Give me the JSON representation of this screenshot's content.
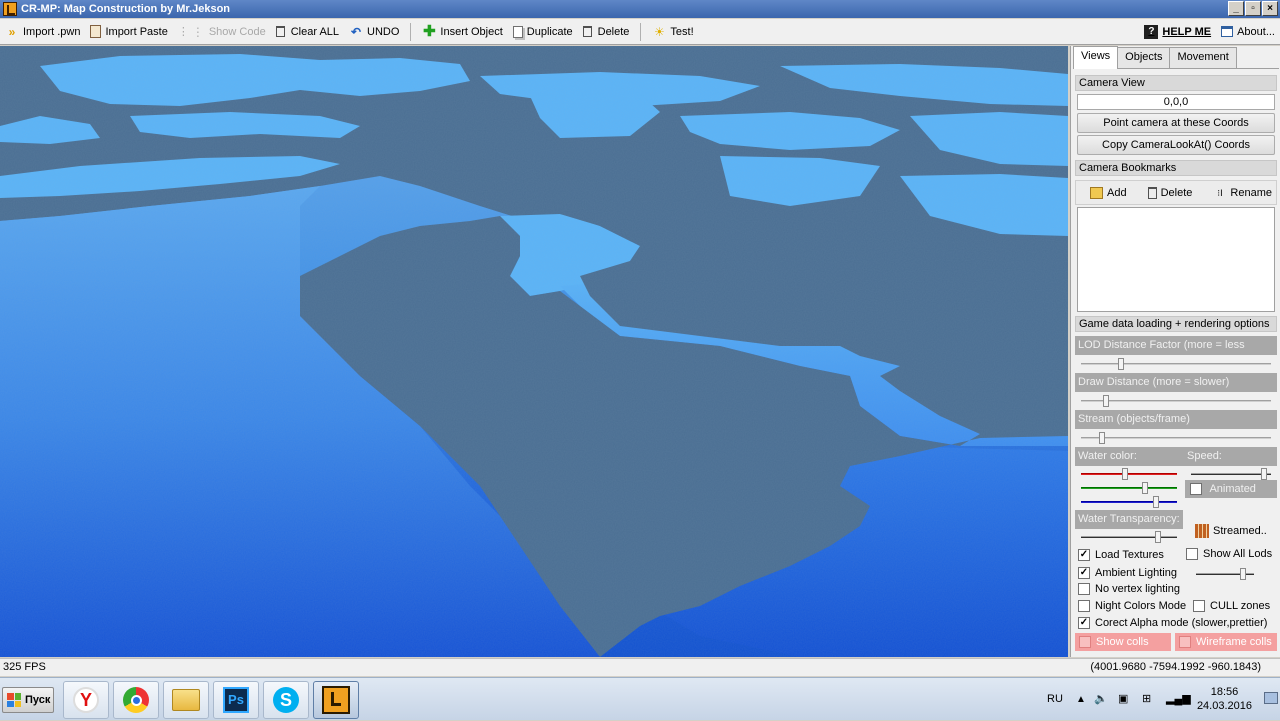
{
  "window": {
    "title": "CR-MP: Map Construction by Mr.Jekson",
    "buttons": [
      "_",
      "▫",
      "×"
    ]
  },
  "toolbar": {
    "import_pwn": "Import .pwn",
    "import_paste": "Import Paste",
    "show_code": "Show Code",
    "clear_all": "Clear ALL",
    "undo": "UNDO",
    "insert_object": "Insert Object",
    "duplicate": "Duplicate",
    "delete": "Delete",
    "test": "Test!",
    "help_me": "HELP ME",
    "about": "About..."
  },
  "panel": {
    "tabs": [
      "Views",
      "Objects",
      "Movement"
    ],
    "active_tab": "Views",
    "camera_view": {
      "header": "Camera View",
      "coords_value": "0,0,0",
      "point_button": "Point camera at these Coords",
      "copy_button": "Copy CameraLookAt() Coords"
    },
    "bookmarks": {
      "header": "Camera Bookmarks",
      "add": "Add",
      "delete": "Delete",
      "rename": "Rename"
    },
    "rendering": {
      "header": "Game data loading + rendering options",
      "lod_label": "LOD Distance Factor (more = less LODs)",
      "lod_level": 0.2,
      "draw_distance_label": "Draw Distance (more = slower)",
      "draw_distance_level": 0.12,
      "stream_label": "Stream (objects/frame)",
      "stream_level": 0.1,
      "water_color_label": "Water color:",
      "speed_label": "Speed:",
      "water_red_level": 0.45,
      "water_green_level": 0.68,
      "water_blue_level": 0.8,
      "speed_level": 0.95,
      "animated_label": "Animated",
      "animated_checked": false,
      "water_transparency_label": "Water Transparency:",
      "water_transparency_level": 0.82,
      "streamed_label": "Streamed..",
      "load_textures": "Load Textures",
      "load_textures_checked": true,
      "show_all_lods": "Show All Lods",
      "show_all_lods_checked": false,
      "ambient_lighting": "Ambient Lighting",
      "ambient_lighting_checked": true,
      "ambient_level": 0.85,
      "no_vertex_lighting": "No vertex lighting",
      "no_vertex_lighting_checked": false,
      "night_colors": "Night Colors Mode",
      "night_colors_checked": false,
      "cull_zones": "CULL zones",
      "cull_zones_checked": false,
      "correct_alpha": "Corect Alpha mode (slower,prettier)",
      "correct_alpha_checked": true,
      "show_colls": "Show colls",
      "wireframe_colls": "Wireframe colls"
    }
  },
  "status": {
    "fps": "325 FPS",
    "position": "(4001.9680 -7594.1992 -960.1843)"
  },
  "taskbar": {
    "start_label": "Пуск",
    "apps": [
      "yandex-browser",
      "chrome",
      "file-explorer",
      "photoshop",
      "skype",
      "cr-mp"
    ],
    "lang": "RU",
    "time": "18:56",
    "date": "24.03.2016"
  },
  "colors": {
    "water_light": "#5ab4f8",
    "ground": "#4a6e92",
    "sky_deep": "#1050d0",
    "title_bar": "#4a75b8"
  }
}
